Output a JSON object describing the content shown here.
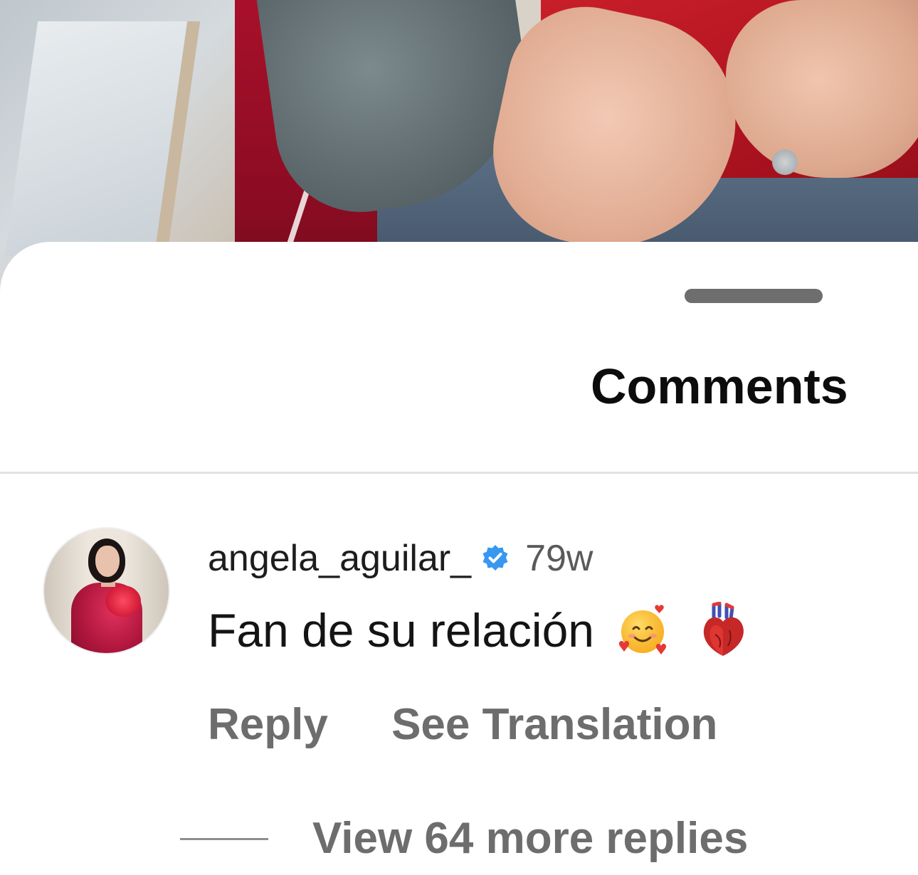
{
  "sheet": {
    "title": "Comments"
  },
  "comment": {
    "username": "angela_aguilar_",
    "time": "79w",
    "text": "Fan de su relación",
    "emojis": [
      "smiling-face-with-hearts-emoji",
      "anatomical-heart-emoji"
    ],
    "reply_label": "Reply",
    "translate_label": "See Translation",
    "verified_color": "#3897f0"
  },
  "replies": {
    "view_more_label": "View 64 more replies"
  }
}
